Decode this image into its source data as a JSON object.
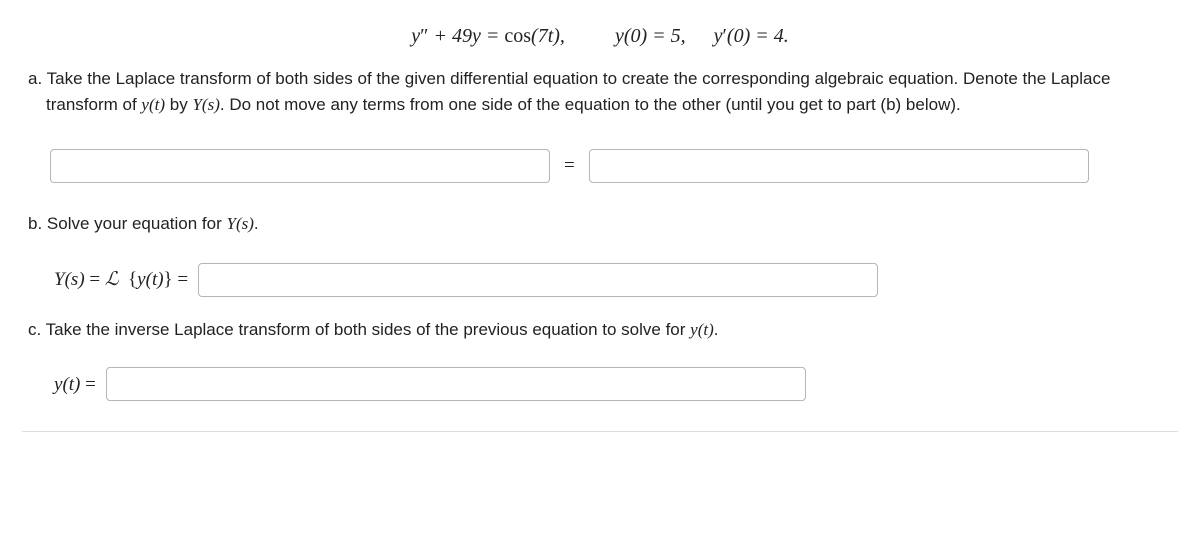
{
  "equation": {
    "lhs": "y″ + 49y = cos(7t),",
    "ic1": "y(0) = 5,",
    "ic2": "y′(0) = 4."
  },
  "partA": {
    "label": "a.",
    "text1": "Take the Laplace transform of both sides of the given differential equation to create the corresponding algebraic equation. Denote the Laplace transform of ",
    "yt": "y(t)",
    "text2": " by ",
    "Ys": "Y(s)",
    "text3": ". Do not move any terms from one side of the equation to the other (until you get to part (b) below).",
    "eq_sign": "="
  },
  "partB": {
    "label": "b.",
    "text": "Solve your equation for ",
    "Ys": "Y(s)",
    "period": ".",
    "prefix_Ys": "Y(s)",
    "prefix_eq": " = ",
    "prefix_L": "ℒ",
    "prefix_brace_open": "{",
    "prefix_yt": "y(t)",
    "prefix_brace_close": "}",
    "prefix_eq2": " ="
  },
  "partC": {
    "label": "c.",
    "text": "Take the inverse Laplace transform of both sides of the previous equation to solve for ",
    "yt": "y(t)",
    "period": ".",
    "prefix_yt": "y(t)",
    "prefix_eq": " ="
  }
}
